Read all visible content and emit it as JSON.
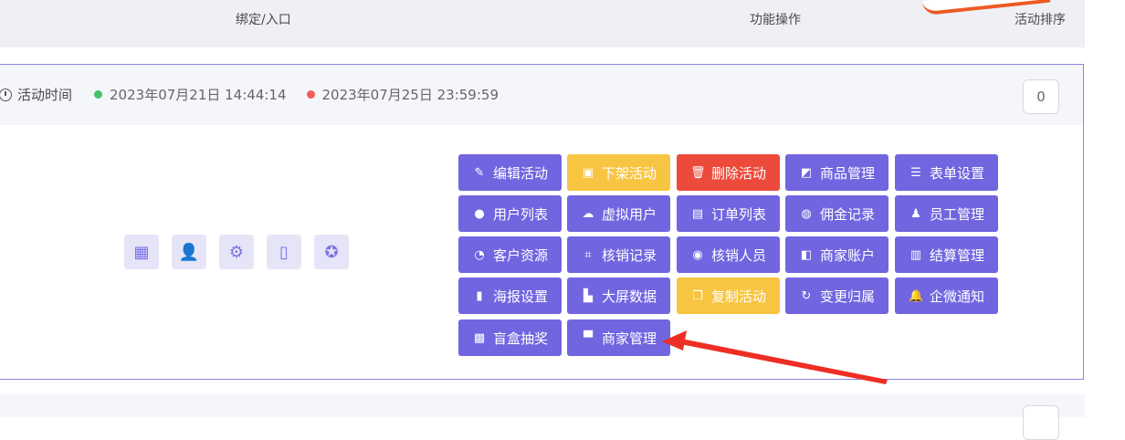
{
  "header": {
    "bind_col": "绑定/入口",
    "ops_col": "功能操作",
    "sort_col": "活动排序"
  },
  "activity": {
    "time_label": "活动时间",
    "start_time": "2023年07月21日 14:44:14",
    "end_time": "2023年07月25日 23:59:59",
    "sort_value": "0",
    "colors": {
      "start_dot": "#45c26a",
      "end_dot": "#f25a5a"
    }
  },
  "quick_icons": [
    {
      "name": "qrcode-icon",
      "glyph": "▦"
    },
    {
      "name": "user-link-icon",
      "glyph": "👤"
    },
    {
      "name": "gear-icon",
      "glyph": "⚙"
    },
    {
      "name": "mobile-icon",
      "glyph": "▯"
    },
    {
      "name": "compass-icon",
      "glyph": "✪"
    }
  ],
  "buttons": [
    {
      "label": "编辑活动",
      "icon": "✎",
      "name": "edit-activity",
      "color": "#7166e0"
    },
    {
      "label": "下架活动",
      "icon": "▣",
      "name": "unlist-activity",
      "color": "#f8c542"
    },
    {
      "label": "删除活动",
      "icon": "🗑",
      "name": "delete-activity",
      "color": "#ec4a3b"
    },
    {
      "label": "商品管理",
      "icon": "◩",
      "name": "goods-management",
      "color": "#7166e0"
    },
    {
      "label": "表单设置",
      "icon": "☰",
      "name": "form-settings",
      "color": "#7166e0"
    },
    {
      "label": "用户列表",
      "icon": "●",
      "name": "user-list",
      "color": "#7166e0"
    },
    {
      "label": "虚拟用户",
      "icon": "☁",
      "name": "virtual-users",
      "color": "#7166e0"
    },
    {
      "label": "订单列表",
      "icon": "▤",
      "name": "order-list",
      "color": "#7166e0"
    },
    {
      "label": "佣金记录",
      "icon": "◍",
      "name": "commission-records",
      "color": "#7166e0"
    },
    {
      "label": "员工管理",
      "icon": "♟",
      "name": "staff-management",
      "color": "#7166e0"
    },
    {
      "label": "客户资源",
      "icon": "◔",
      "name": "customer-resources",
      "color": "#7166e0"
    },
    {
      "label": "核销记录",
      "icon": "⌗",
      "name": "verification-records",
      "color": "#7166e0"
    },
    {
      "label": "核销人员",
      "icon": "◉",
      "name": "verification-staff",
      "color": "#7166e0"
    },
    {
      "label": "商家账户",
      "icon": "◧",
      "name": "merchant-account",
      "color": "#7166e0"
    },
    {
      "label": "结算管理",
      "icon": "▥",
      "name": "settlement-management",
      "color": "#7166e0"
    },
    {
      "label": "海报设置",
      "icon": "▮",
      "name": "poster-settings",
      "color": "#7166e0"
    },
    {
      "label": "大屏数据",
      "icon": "▙",
      "name": "big-screen-data",
      "color": "#7166e0"
    },
    {
      "label": "复制活动",
      "icon": "❐",
      "name": "copy-activity",
      "color": "#f8c542"
    },
    {
      "label": "变更归属",
      "icon": "↻",
      "name": "change-ownership",
      "color": "#7166e0"
    },
    {
      "label": "企微通知",
      "icon": "🔔",
      "name": "wecom-notify",
      "color": "#7166e0"
    },
    {
      "label": "盲盒抽奖",
      "icon": "▩",
      "name": "blind-box-lottery",
      "color": "#7166e0"
    },
    {
      "label": "商家管理",
      "icon": "▀",
      "name": "merchant-management",
      "color": "#7166e0"
    }
  ]
}
